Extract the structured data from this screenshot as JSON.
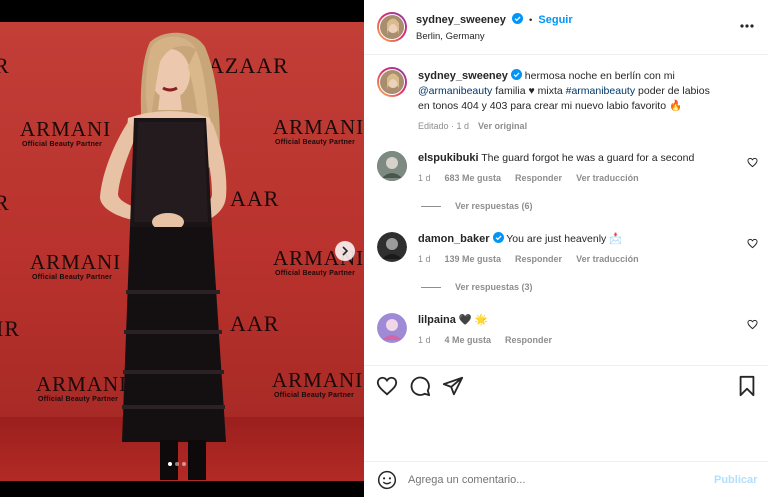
{
  "post": {
    "username": "sydney_sweeney",
    "follow_label": "Seguir",
    "location": "Berlin, Germany",
    "separator": "•"
  },
  "photo": {
    "backdrop_brand": "ARMANI",
    "backdrop_partner": "Official Beauty Partner",
    "backdrop_magazine_partial": "AZAAR",
    "backdrop_magazine_tail": "AAR",
    "backdrop_edge_left": "R",
    "backdrop_edge_left2": "IR",
    "carousel_count": 3,
    "carousel_index": 1
  },
  "caption": {
    "username": "sydney_sweeney",
    "text_1": " hermosa noche en berlín con mi",
    "mention": "@armanibeauty",
    "text_2": " familia ♥ mixta ",
    "hashtag": "#armanibeauty",
    "text_3": " poder de labios",
    "text_4": "en tonos 404 y 403 para crear mi nuevo labio favorito 🔥",
    "edited": "Editado · 1 d",
    "see_original": "Ver original"
  },
  "comments": [
    {
      "username": "elspukibuki",
      "text": "The guard forgot he was a guard for a second",
      "time": "1 d",
      "likes": "683 Me gusta",
      "reply": "Responder",
      "translate": "Ver traducción",
      "view_replies": "Ver respuestas (6)",
      "verified": false
    },
    {
      "username": "damon_baker",
      "text": "You are just heavenly 📩",
      "time": "1 d",
      "likes": "139 Me gusta",
      "reply": "Responder",
      "translate": "Ver traducción",
      "view_replies": "Ver respuestas (3)",
      "verified": true
    },
    {
      "username": "lilpaina",
      "text": "🖤 🌟",
      "time": "1 d",
      "likes": "4 Me gusta",
      "reply": "Responder",
      "verified": false
    }
  ],
  "composer": {
    "placeholder": "Agrega un comentario...",
    "publish": "Publicar"
  },
  "colors": {
    "accent": "#0095f6",
    "verified": "#0095f6",
    "backdrop": "#b9322d"
  },
  "icons": [
    "more-icon",
    "verified-icon",
    "heart-icon",
    "comment-icon",
    "share-icon",
    "bookmark-icon",
    "emoji-icon",
    "chevron-right-icon"
  ]
}
